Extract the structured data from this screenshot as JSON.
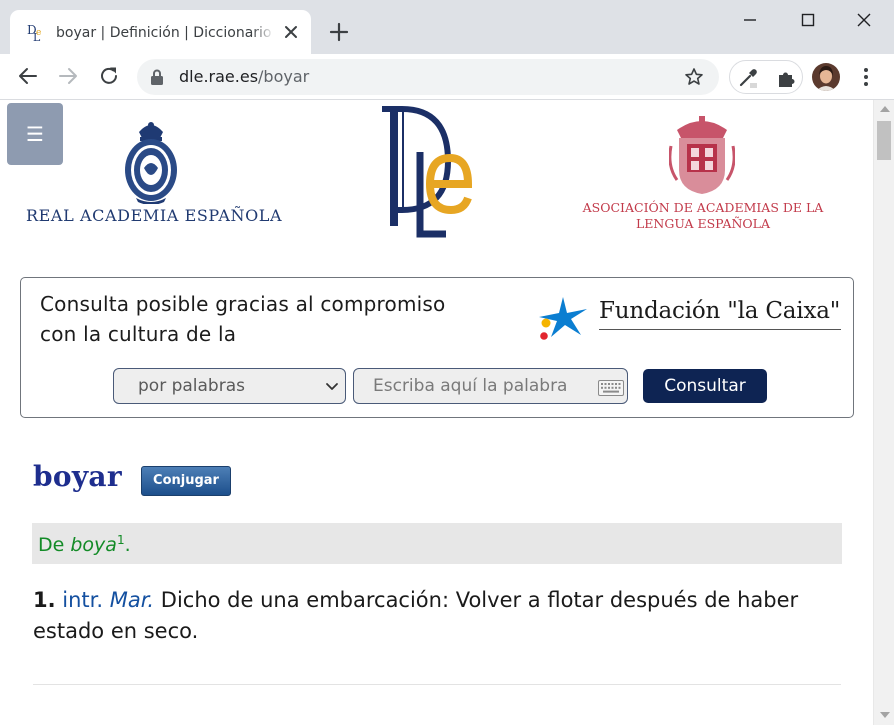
{
  "browser": {
    "tab": {
      "title": "boyar | Definición | Diccionario de la lengua española | RAE - ASALE"
    },
    "address_bar": {
      "host": "dle.rae.es",
      "path": "/boyar"
    }
  },
  "header": {
    "menu_glyph": "☰",
    "rae_logo_text": "REAL ACADEMIA ESPAÑOLA",
    "dle_logo_text": "DLE",
    "asale_logo_text": [
      "ASOCIACIÓN DE ACADEMIAS DE LA",
      "LENGUA ESPAÑOLA"
    ]
  },
  "search": {
    "sponsor_text": "Consulta posible gracias al compromiso con la cultura de la",
    "sponsor_name": "Fundación \"la Caixa\"",
    "mode_selected": "por palabras",
    "input_placeholder": "Escriba aquí la palabra",
    "submit_label": "Consultar"
  },
  "entry": {
    "headword": "boyar",
    "conjugate_label": "Conjugar",
    "etymology": {
      "prefix": "De",
      "word": "boya",
      "superscript": "1",
      "suffix": "."
    },
    "definitions": [
      {
        "number": "1.",
        "category": "intr.",
        "domain": "Mar.",
        "text": "Dicho de una embarcación: Volver a flotar después de haber estado en seco."
      }
    ]
  },
  "colors": {
    "brand_navy": "#0e2453",
    "headword_blue": "#1e2e8e",
    "etymology_green": "#138b27",
    "abbreviation_blue": "#1450a0",
    "asale_red": "#c23a4a"
  }
}
